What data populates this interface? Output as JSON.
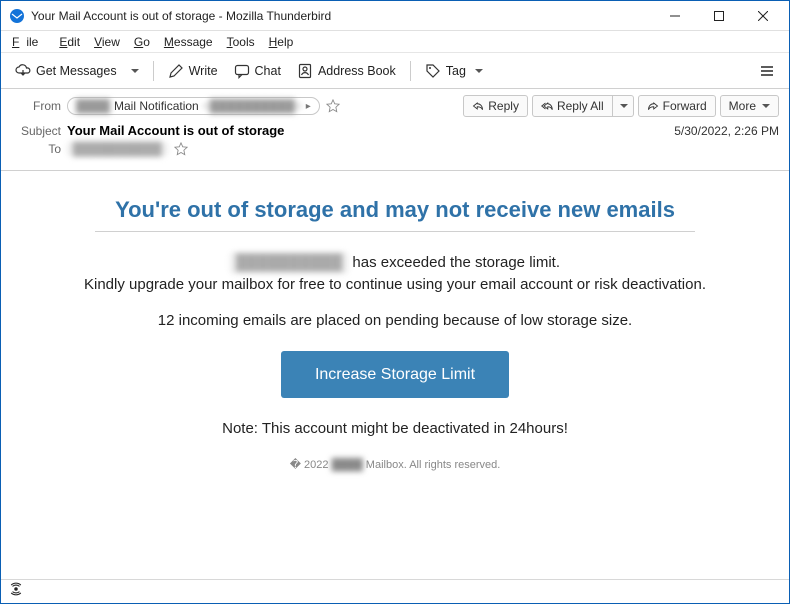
{
  "window": {
    "title": "Your Mail Account is out of storage - Mozilla Thunderbird"
  },
  "menu": {
    "file": "File",
    "edit": "Edit",
    "view": "View",
    "go": "Go",
    "message": "Message",
    "tools": "Tools",
    "help": "Help"
  },
  "toolbar": {
    "get_messages": "Get Messages",
    "write": "Write",
    "chat": "Chat",
    "address_book": "Address Book",
    "tag": "Tag"
  },
  "actions": {
    "reply": "Reply",
    "reply_all": "Reply All",
    "forward": "Forward",
    "more": "More"
  },
  "header": {
    "from_label": "From",
    "from_name_prefix": "████",
    "from_name": "Mail Notification",
    "from_addr": "<██████████>",
    "subject_label": "Subject",
    "subject": "Your Mail Account is out of storage",
    "datetime": "5/30/2022, 2:26 PM",
    "to_label": "To",
    "to_value": "██████████"
  },
  "body": {
    "headline": "You're out of storage and may not receive new emails",
    "line1_prefix": "██████████",
    "line1_suffix": " has exceeded the storage limit.",
    "line2": "Kindly upgrade your mailbox for free to continue using your email account or risk deactivation.",
    "line3": "12 incoming emails are placed on pending because of low storage size.",
    "cta": "Increase Storage Limit",
    "note": "Note: This account might be deactivated in 24hours!",
    "footer_prefix": "� 2022 ",
    "footer_blur": "████",
    "footer_suffix": " Mailbox. All rights reserved."
  }
}
